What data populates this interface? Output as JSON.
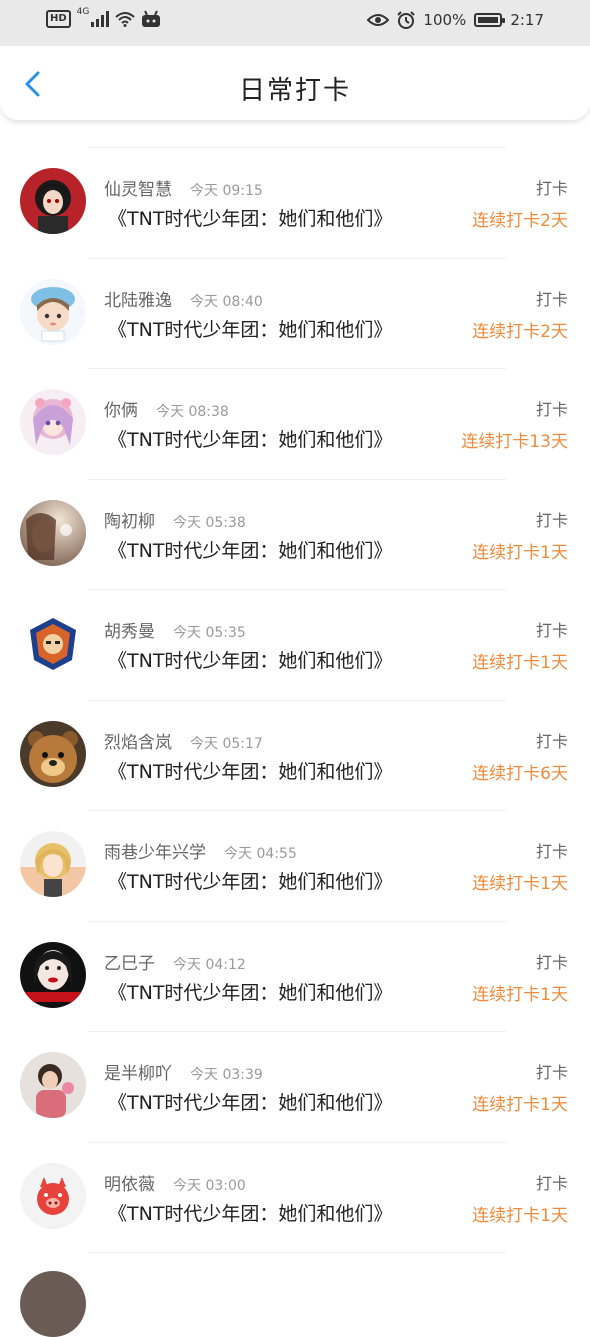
{
  "status_bar": {
    "hd": "HD",
    "network": "4G",
    "battery_percent": "100%",
    "battery_level": 1.0,
    "time": "2:17",
    "icons": [
      "signal-icon",
      "wifi-icon",
      "notification-icon",
      "eye-icon",
      "alarm-icon",
      "battery-icon"
    ]
  },
  "header": {
    "title": "日常打卡",
    "back_icon": "chevron-left-icon",
    "accent_color": "#2a92e6"
  },
  "colors": {
    "streak": "#f08a3c",
    "name": "#666666",
    "time": "#9a9a9a"
  },
  "checkins": [
    {
      "name": "仙灵智慧",
      "time": "今天 09:15",
      "book": "《TNT时代少年团：她们和他们》",
      "action": "打卡",
      "streak": "连续打卡2天",
      "avatar": "avatar-red-anime"
    },
    {
      "name": "北陆雅逸",
      "time": "今天 08:40",
      "book": "《TNT时代少年团：她们和他们》",
      "action": "打卡",
      "streak": "连续打卡2天",
      "avatar": "avatar-chibi-blue"
    },
    {
      "name": "你俩",
      "time": "今天 08:38",
      "book": "《TNT时代少年团：她们和他们》",
      "action": "打卡",
      "streak": "连续打卡13天",
      "avatar": "avatar-pink-anime"
    },
    {
      "name": "陶初柳",
      "time": "今天 05:38",
      "book": "《TNT时代少年团：她们和他们》",
      "action": "打卡",
      "streak": "连续打卡1天",
      "avatar": "avatar-photo-girl"
    },
    {
      "name": "胡秀曼",
      "time": "今天 05:35",
      "book": "《TNT时代少年团：她们和他们》",
      "action": "打卡",
      "streak": "连续打卡1天",
      "avatar": "avatar-emblem"
    },
    {
      "name": "烈焰含岚",
      "time": "今天 05:17",
      "book": "《TNT时代少年团：她们和他们》",
      "action": "打卡",
      "streak": "连续打卡6天",
      "avatar": "avatar-bear"
    },
    {
      "name": "雨巷少年兴学",
      "time": "今天 04:55",
      "book": "《TNT时代少年团：她们和他们》",
      "action": "打卡",
      "streak": "连续打卡1天",
      "avatar": "avatar-blonde-anime"
    },
    {
      "name": "乙巳子",
      "time": "今天 04:12",
      "book": "《TNT时代少年团：她们和他们》",
      "action": "打卡",
      "streak": "连续打卡1天",
      "avatar": "avatar-red-lips"
    },
    {
      "name": "是半柳吖",
      "time": "今天 03:39",
      "book": "《TNT时代少年团：她们和他们》",
      "action": "打卡",
      "streak": "连续打卡1天",
      "avatar": "avatar-child-photo"
    },
    {
      "name": "明依薇",
      "time": "今天 03:00",
      "book": "《TNT时代少年团：她们和他们》",
      "action": "打卡",
      "streak": "连续打卡1天",
      "avatar": "avatar-pig"
    }
  ]
}
